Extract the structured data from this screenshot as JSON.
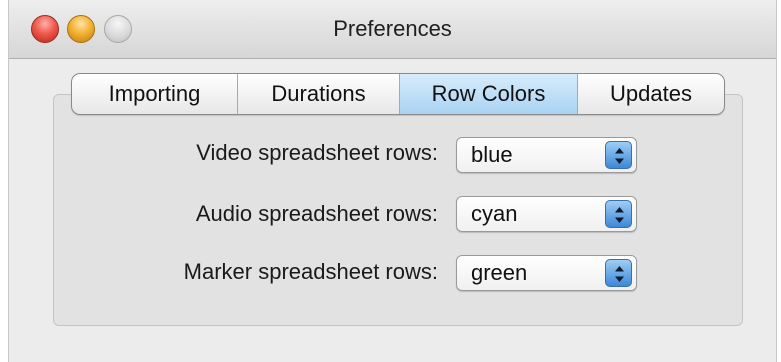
{
  "window": {
    "title": "Preferences"
  },
  "tabs": [
    {
      "label": "Importing",
      "selected": false
    },
    {
      "label": "Durations",
      "selected": false
    },
    {
      "label": "Row Colors",
      "selected": true
    },
    {
      "label": "Updates",
      "selected": false
    }
  ],
  "rows": [
    {
      "label": "Video spreadsheet rows:",
      "value": "blue"
    },
    {
      "label": "Audio spreadsheet rows:",
      "value": "cyan"
    },
    {
      "label": "Marker spreadsheet rows:",
      "value": "green"
    }
  ],
  "icons": {
    "close": "close-button-icon",
    "minimize": "minimize-button-icon",
    "zoom": "zoom-button-icon",
    "popup": "up-down-arrows-icon"
  },
  "colors": {
    "selected_tab": "#a9d3f3",
    "popup_arrow": "#3d88d8"
  }
}
